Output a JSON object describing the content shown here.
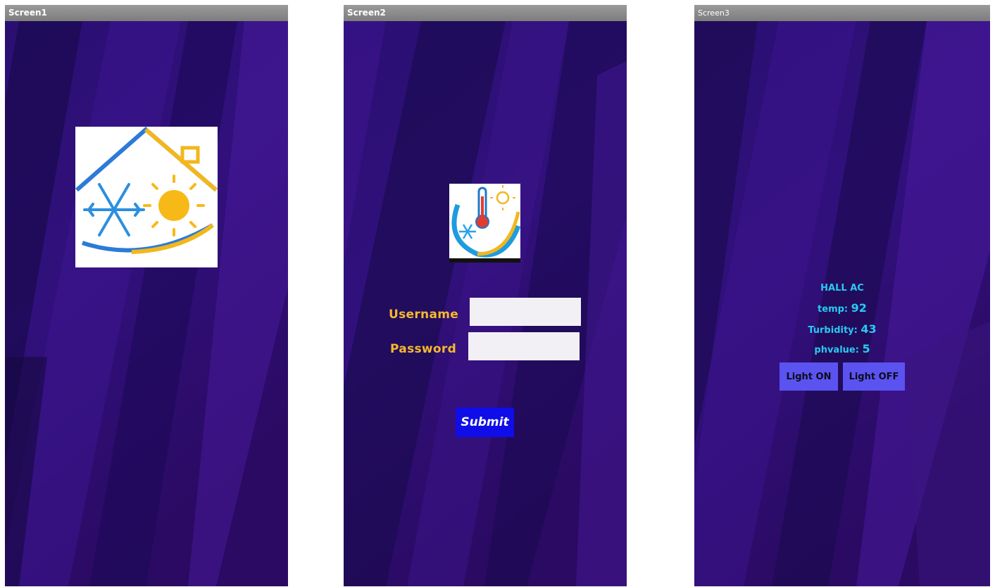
{
  "screens": [
    {
      "title": "Screen1"
    },
    {
      "title": "Screen2"
    },
    {
      "title": "Screen3"
    }
  ],
  "login": {
    "username_label": "Username",
    "password_label": "Password",
    "username_value": "",
    "password_value": "",
    "submit_label": "Submit"
  },
  "dashboard": {
    "device_name": "HALL AC",
    "temp_label": "temp:",
    "temp_value": "92",
    "turbidity_label": "Turbidity:",
    "turbidity_value": "43",
    "ph_label": "phvalue:",
    "ph_value": "5",
    "light_on_label": "Light ON",
    "light_off_label": "Light OFF"
  },
  "colors": {
    "background": "#2b0f6e",
    "titlebar": "#8a8a8a",
    "label_gold": "#f5b92c",
    "submit_blue": "#0f0de8",
    "info_cyan": "#29c9f2",
    "light_button": "#5b53f0"
  },
  "icons": {
    "splash_logo": "house-snowflake-sun-logo",
    "login_logo": "thermometer-snowflake-sun-logo"
  }
}
